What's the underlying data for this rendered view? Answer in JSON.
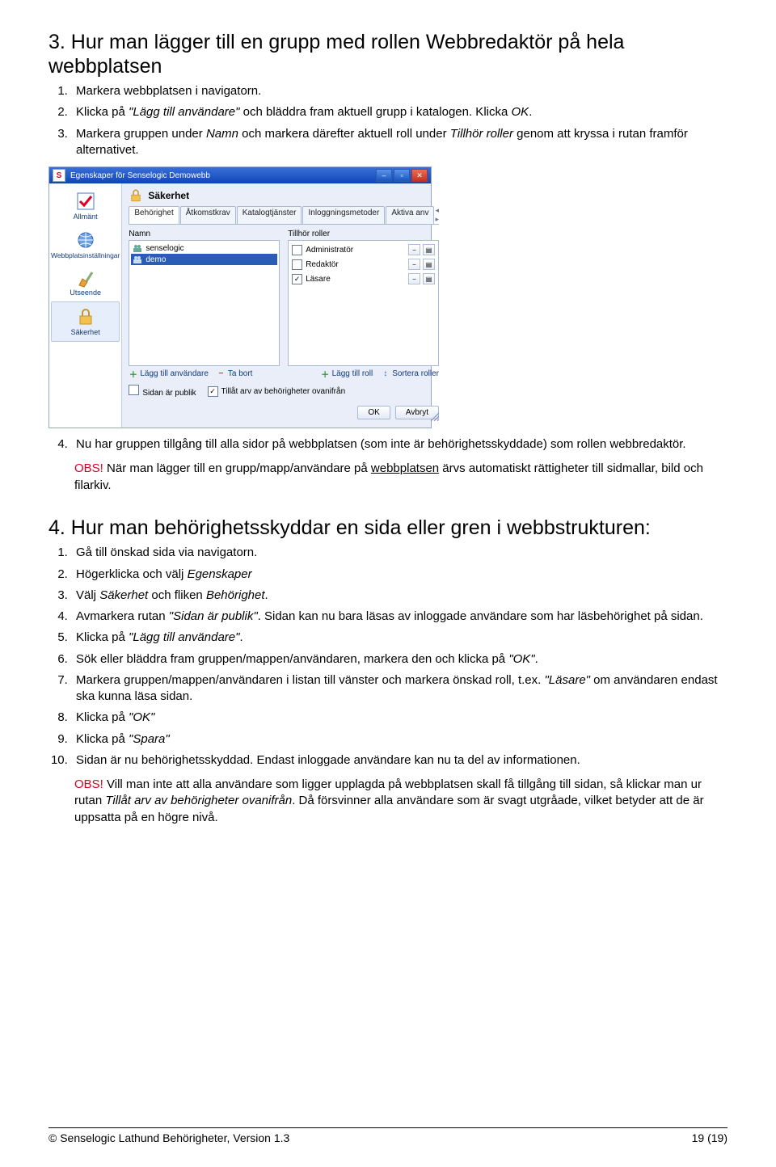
{
  "section3": {
    "title": "3. Hur man lägger till en grupp med rollen Webbredaktör på hela webbplatsen",
    "steps": [
      {
        "n": "1.",
        "t": "Markera webbplatsen i navigatorn."
      },
      {
        "n": "2.",
        "pre": "Klicka på ",
        "ital": "\"Lägg till användare\"",
        "mid": " och bläddra fram aktuell grupp i katalogen. Klicka ",
        "ital2": "OK",
        "post": "."
      },
      {
        "n": "3.",
        "pre": "Markera gruppen  under ",
        "ital": "Namn",
        "mid": " och markera därefter aktuell roll under ",
        "ital2": "Tillhör roller",
        "post": " genom att kryssa i rutan framför alternativet."
      }
    ],
    "step4": "Nu har gruppen tillgång till alla sidor på webbplatsen (som inte är behörighetsskyddade) som rollen webbredaktör.",
    "obs_label": "OBS!",
    "obs_text_pre": " När man lägger till en grupp/mapp/användare på ",
    "obs_link": "webbplatsen",
    "obs_text_post": " ärvs automatiskt rättigheter till sidmallar, bild och filarkiv."
  },
  "screenshot": {
    "win_title": "Egenskaper för Senselogic Demowebb",
    "sidebar": [
      "Allmänt",
      "Webbplatsinställningar",
      "Utseende",
      "Säkerhet"
    ],
    "header": "Säkerhet",
    "tabs": [
      "Behörighet",
      "Åtkomstkrav",
      "Katalogtjänster",
      "Inloggningsmetoder",
      "Aktiva anv"
    ],
    "left_label": "Namn",
    "right_label": "Tillhör roller",
    "names": [
      {
        "t": "senselogic",
        "sel": false
      },
      {
        "t": "demo",
        "sel": true
      }
    ],
    "roles": [
      {
        "t": "Administratör",
        "chk": false
      },
      {
        "t": "Redaktör",
        "chk": false
      },
      {
        "t": "Läsare",
        "chk": true
      }
    ],
    "btn_add_user": "Lägg till användare",
    "btn_remove": "Ta bort",
    "btn_add_role": "Lägg till roll",
    "btn_sort": "Sortera roller",
    "opt_public": "Sidan är publik",
    "opt_inherit": "Tillåt arv av behörigheter ovanifrån",
    "btn_ok": "OK",
    "btn_cancel": "Avbryt"
  },
  "section4": {
    "title": "4. Hur man behörighetsskyddar en sida eller gren i webbstrukturen:",
    "li1": "Gå till önskad sida via navigatorn.",
    "li2_pre": "Högerklicka och välj ",
    "li2_ital": "Egenskaper",
    "li3_pre": "Välj ",
    "li3_i1": "Säkerhet",
    "li3_mid": " och fliken ",
    "li3_i2": "Behörighet",
    "li3_post": ".",
    "li4_pre": "Avmarkera rutan ",
    "li4_ital": "\"Sidan är publik\"",
    "li4_post": ". Sidan kan nu bara läsas av inloggade användare som har läsbehörighet på sidan.",
    "li5_pre": "Klicka på ",
    "li5_ital": "\"Lägg till användare\"",
    "li5_post": ".",
    "li6_pre": "Sök eller bläddra fram gruppen/mappen/användaren,  markera den och klicka på ",
    "li6_ital": "\"OK\"",
    "li6_post": ".",
    "li7_pre": "Markera gruppen/mappen/användaren i listan till vänster och markera önskad roll, t.ex. ",
    "li7_ital": "\"Läsare\"",
    "li7_post": " om användaren endast ska kunna läsa sidan.",
    "li8_pre": "Klicka på ",
    "li8_ital": "\"OK\"",
    "li9_pre": "Klicka på ",
    "li9_ital": "\"Spara\"",
    "li10": "Sidan är nu behörighetsskyddad. Endast inloggade användare kan nu ta del av informationen.",
    "obs_label": "OBS!",
    "obs_pre": " Vill man inte att alla användare som ligger upplagda på webbplatsen skall få tillgång till sidan, så klickar man ur rutan ",
    "obs_ital": "Tillåt arv av behörigheter ovanifrån",
    "obs_post": ". Då försvinner alla användare som är svagt utgråade, vilket betyder att de är uppsatta på en högre nivå."
  },
  "footer": {
    "left": "© Senselogic Lathund Behörigheter, Version 1.3",
    "right": "19 (19)"
  }
}
